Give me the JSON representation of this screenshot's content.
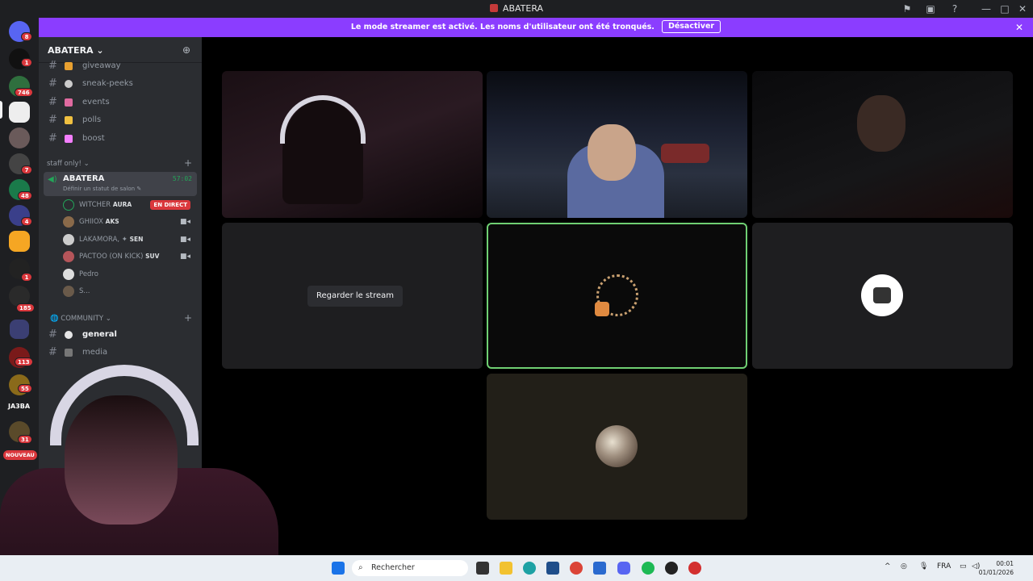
{
  "window": {
    "title": "ABATERA"
  },
  "banner": {
    "message": "Le mode streamer est activé. Les noms d'utilisateur ont été tronqués.",
    "button": "Désactiver"
  },
  "rail": {
    "badges": [
      "8",
      "1",
      "746",
      "7",
      "48",
      "4",
      "1",
      "185",
      "113",
      "55",
      "31"
    ],
    "new_label": "NOUVEAU",
    "server_text": "JA3BA"
  },
  "server": {
    "name": "ABATERA"
  },
  "channels": [
    {
      "name": "giveaway"
    },
    {
      "name": "sneak-peeks"
    },
    {
      "name": "events"
    },
    {
      "name": "polls"
    },
    {
      "name": "boost"
    }
  ],
  "staff_category": "staff only!",
  "voice_channel": {
    "name": "ABATERA",
    "timer": "57:02",
    "status": "Définir un statut de salon"
  },
  "members": [
    {
      "name": "WITCHER",
      "tag": "AURA",
      "live": "EN DIRECT"
    },
    {
      "name": "GHIIOX",
      "tag": "AKS"
    },
    {
      "name": "LAKAMORA, ✦",
      "tag": "SEN"
    },
    {
      "name": "PACTOO (ON KICK)",
      "tag": "SUV"
    },
    {
      "name": "Pedro"
    },
    {
      "name": "S..."
    }
  ],
  "community_category": "COMMUNITY",
  "community_channels": [
    {
      "name": "general"
    },
    {
      "name": "media"
    }
  ],
  "video": {
    "watch_button": "Regarder le stream"
  },
  "taskbar": {
    "search_placeholder": "Rechercher",
    "lang": "FRA",
    "time": "00:01",
    "date": "01/01/2026"
  },
  "colors": {
    "banner": "#8b3dff",
    "voice_green": "#23a559",
    "live_red": "#da373c",
    "active_border": "#6fcf73"
  }
}
